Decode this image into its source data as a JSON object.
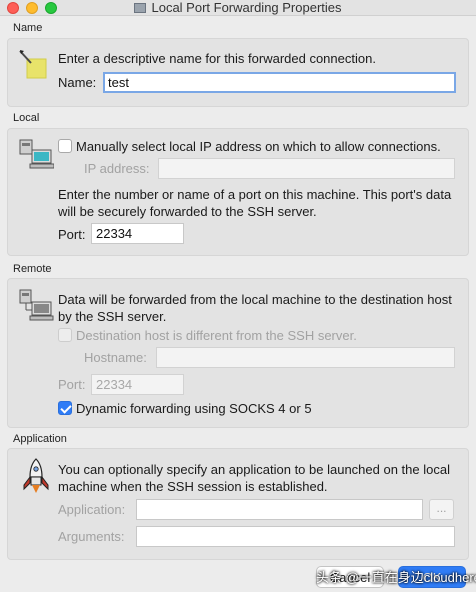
{
  "window": {
    "title": "Local Port Forwarding Properties"
  },
  "name_section": {
    "label": "Name",
    "description": "Enter a descriptive name for this forwarded connection.",
    "name_label": "Name:",
    "name_value": "test"
  },
  "local_section": {
    "label": "Local",
    "checkbox_label": "Manually select local IP address on which to allow connections.",
    "ip_label": "IP address:",
    "ip_value": "",
    "port_description": "Enter the number or name of a port on this machine.  This port's data will be securely forwarded to the SSH server.",
    "port_label": "Port:",
    "port_value": "22334"
  },
  "remote_section": {
    "label": "Remote",
    "description": "Data will be forwarded from the local machine to the destination host by the SSH server.",
    "dest_checkbox_label": "Destination host is different from the SSH server.",
    "hostname_label": "Hostname:",
    "hostname_value": "",
    "port_label": "Port:",
    "port_value": "22334",
    "socks_label": "Dynamic forwarding using SOCKS 4 or 5",
    "socks_checked": true
  },
  "application_section": {
    "label": "Application",
    "description": "You can optionally specify an application to be launched on the local machine when the SSH session is established.",
    "application_label": "Application:",
    "application_value": "",
    "browse_label": "...",
    "arguments_label": "Arguments:",
    "arguments_value": ""
  },
  "buttons": {
    "cancel": "Cancel",
    "ok": "OK"
  },
  "watermark": "头条 @一直在身边cloudhere",
  "icons": {
    "window": "terminal-window-icon",
    "name": "pencil-tag-icon",
    "local": "computer-icon",
    "remote": "network-computers-icon",
    "application": "rocket-icon"
  },
  "colors": {
    "accent": "#2f7cf6",
    "focus_ring": "#7aa7e6"
  }
}
